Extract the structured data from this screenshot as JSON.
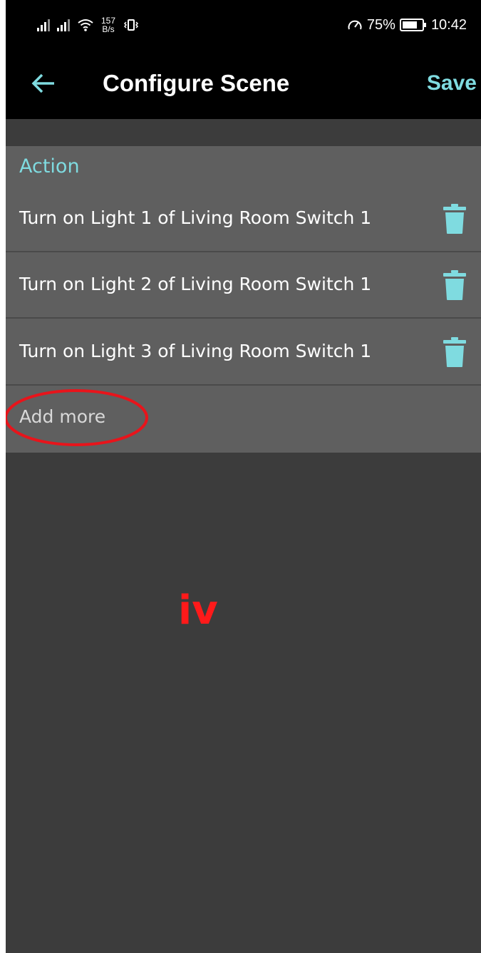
{
  "status_bar": {
    "net_speed_value": "157",
    "net_speed_unit": "B/s",
    "battery": "75%",
    "time": "10:42"
  },
  "app_bar": {
    "title": "Configure Scene",
    "save_label": "Save"
  },
  "action_section": {
    "header": "Action",
    "items": [
      {
        "label": "Turn on Light 1 of Living Room Switch 1"
      },
      {
        "label": "Turn on Light 2 of Living Room Switch 1"
      },
      {
        "label": "Turn on Light 3 of Living Room Switch 1"
      }
    ],
    "add_more_label": "Add more"
  },
  "annotation": {
    "label": "iv",
    "color": "#ff1a1a"
  },
  "colors": {
    "accent": "#7fdbe0",
    "bar_background": "#000000",
    "card_background": "#5f5f5f",
    "screen_background": "#3c3c3c"
  },
  "icons": {
    "back": "arrow-left-icon",
    "delete": "trash-icon",
    "wifi": "wifi-icon",
    "vibrate": "vibrate-icon",
    "gauge": "gauge-icon",
    "battery": "battery-icon"
  }
}
